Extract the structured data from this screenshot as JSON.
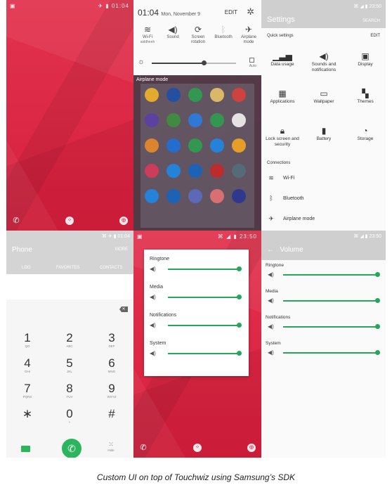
{
  "colors": {
    "wallpaper": "#d61f3d",
    "accent_green": "#26a65b",
    "call_green": "#2bb55c",
    "header_gray": "#cfcfcf"
  },
  "home": {
    "status_time": "01:04",
    "dock_icons": [
      "phone-icon",
      "apps-icon",
      "chrome-icon"
    ]
  },
  "shade": {
    "time": "01:04",
    "date": "Mon, November 9",
    "edit": "EDIT",
    "toggles": [
      {
        "icon": "wifi-icon",
        "label": "Wi-Fi",
        "sub": "aiddheeh"
      },
      {
        "icon": "sound-icon",
        "label": "Sound",
        "sub": ""
      },
      {
        "icon": "screen-rotation-icon",
        "label": "Screen rotation",
        "sub": ""
      },
      {
        "icon": "bluetooth-icon",
        "label": "Bluetooth",
        "sub": ""
      },
      {
        "icon": "airplane-icon",
        "label": "Airplane mode",
        "sub": ""
      }
    ],
    "brightness_fraction": 0.62,
    "auto_label": "Auto",
    "airplane_banner": "Airplane mode"
  },
  "settings": {
    "title": "Settings",
    "search": "SEARCH",
    "quick_settings": "Quick settings",
    "edit": "EDIT",
    "grid": [
      {
        "icon": "data-usage-icon",
        "label": "Data usage"
      },
      {
        "icon": "sound-icon",
        "label": "Sounds and notifications"
      },
      {
        "icon": "display-icon",
        "label": "Display"
      },
      {
        "icon": "applications-icon",
        "label": "Applications"
      },
      {
        "icon": "wallpaper-icon",
        "label": "Wallpaper"
      },
      {
        "icon": "themes-icon",
        "label": "Themes"
      },
      {
        "icon": "lock-icon",
        "label": "Lock screen and security"
      },
      {
        "icon": "battery-icon",
        "label": "Battery"
      },
      {
        "icon": "storage-icon",
        "label": "Storage"
      }
    ],
    "connections": "Connections",
    "conn_items": [
      {
        "icon": "wifi-icon",
        "label": "Wi-Fi"
      },
      {
        "icon": "bluetooth-icon",
        "label": "Bluetooth"
      },
      {
        "icon": "airplane-icon",
        "label": "Airplane mode"
      }
    ]
  },
  "phone": {
    "title": "Phone",
    "more": "MORE",
    "tabs": [
      "LOG",
      "FAVORITES",
      "CONTACTS"
    ],
    "status_time": "01:04",
    "keys": [
      {
        "d": "1",
        "l": "QO"
      },
      {
        "d": "2",
        "l": "ABC"
      },
      {
        "d": "3",
        "l": "DEF"
      },
      {
        "d": "4",
        "l": "GHI"
      },
      {
        "d": "5",
        "l": "JKL"
      },
      {
        "d": "6",
        "l": "MNO"
      },
      {
        "d": "7",
        "l": "PQRS"
      },
      {
        "d": "8",
        "l": "TUV"
      },
      {
        "d": "9",
        "l": "WXYZ"
      },
      {
        "d": "∗",
        "l": ""
      },
      {
        "d": "0",
        "l": "+"
      },
      {
        "d": "#",
        "l": ""
      }
    ],
    "hide": "Hide"
  },
  "volume_dialog": {
    "status_time": "23:50",
    "rows": [
      {
        "label": "Ringtone",
        "level": 1.0
      },
      {
        "label": "Media",
        "level": 1.0
      },
      {
        "label": "Notifications",
        "level": 1.0
      },
      {
        "label": "System",
        "level": 1.0
      }
    ]
  },
  "volume_settings": {
    "title": "Volume",
    "status_time": "23:50",
    "rows": [
      {
        "label": "Ringtone",
        "level": 1.0
      },
      {
        "label": "Media",
        "level": 1.0
      },
      {
        "label": "Notifications",
        "level": 1.0
      },
      {
        "label": "System",
        "level": 1.0
      }
    ]
  },
  "caption": "Custom UI on top of Touchwiz using Samsung’s SDK"
}
